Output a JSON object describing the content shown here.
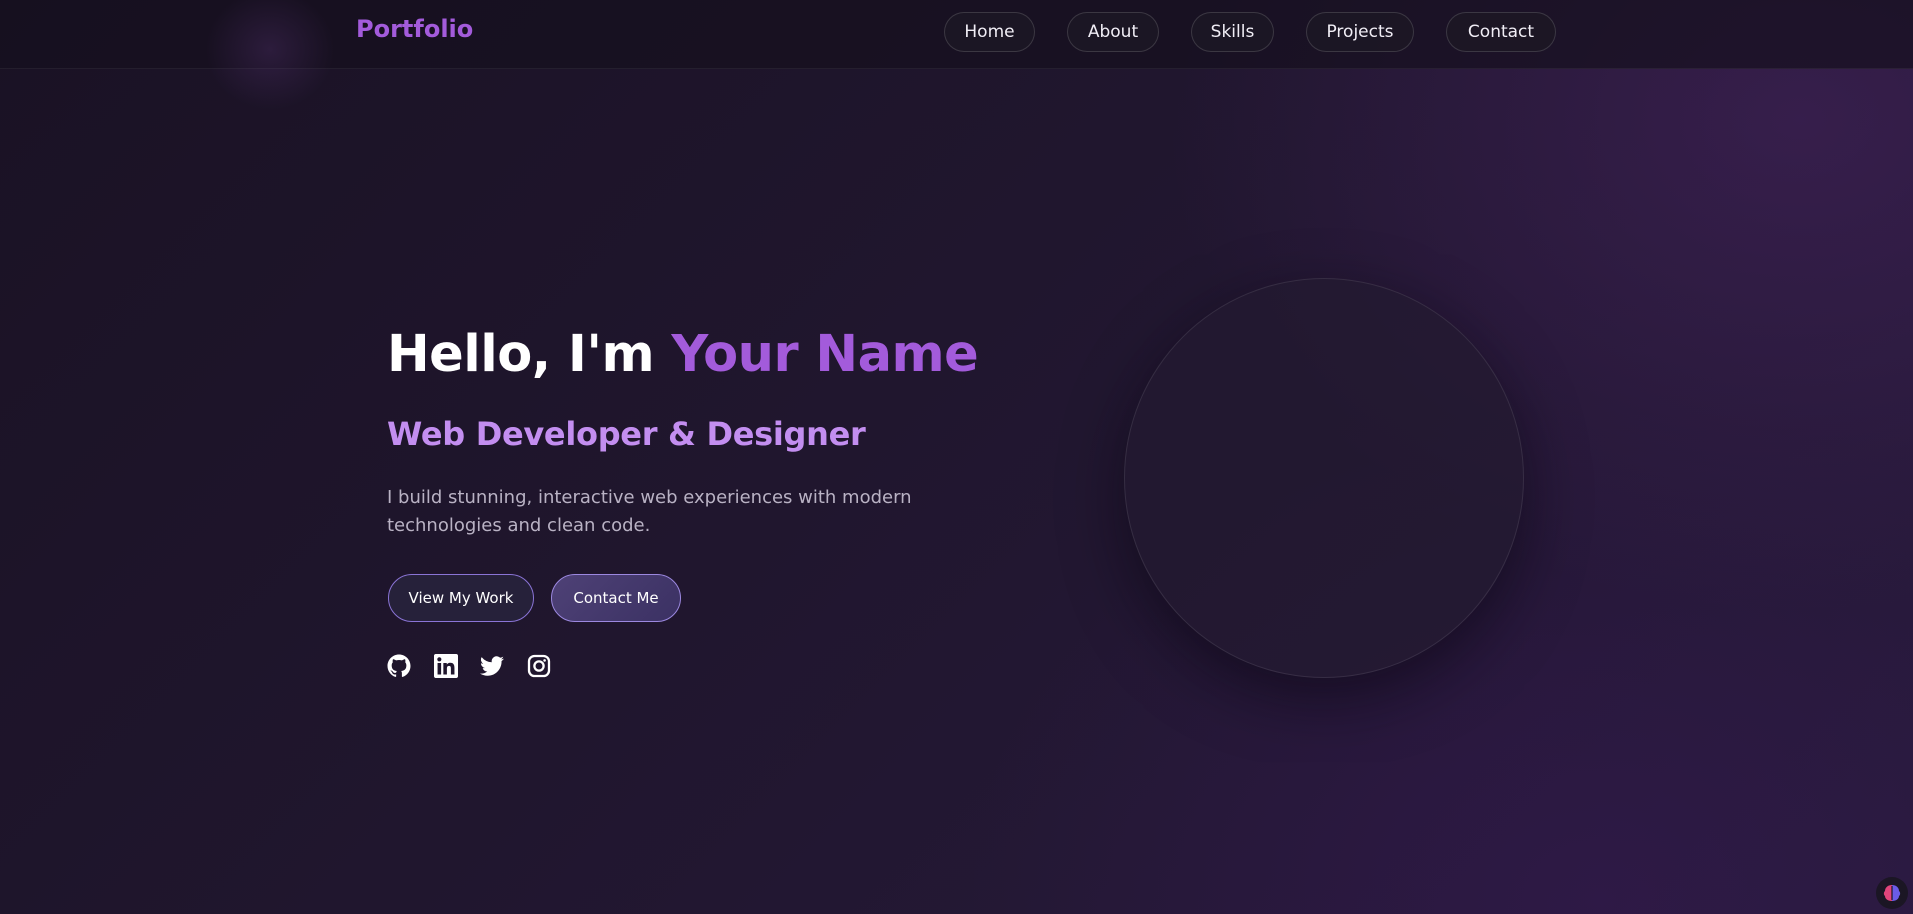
{
  "nav": {
    "logo": "Portfolio",
    "links": [
      {
        "label": "Home"
      },
      {
        "label": "About"
      },
      {
        "label": "Skills"
      },
      {
        "label": "Projects"
      },
      {
        "label": "Contact"
      }
    ]
  },
  "hero": {
    "greeting": "Hello, I'm ",
    "name": "Your Name",
    "subtitle": "Web Developer & Designer",
    "description": "I build stunning, interactive web experiences with modern technologies and clean code.",
    "buttons": {
      "view_work": "View My Work",
      "contact": "Contact Me"
    }
  },
  "social": {
    "icons": [
      "github-icon",
      "linkedin-icon",
      "twitter-icon",
      "instagram-icon"
    ]
  },
  "colors": {
    "accent": "#a35bdb",
    "subtitle": "#c38ef0",
    "background": "#1f162c"
  }
}
